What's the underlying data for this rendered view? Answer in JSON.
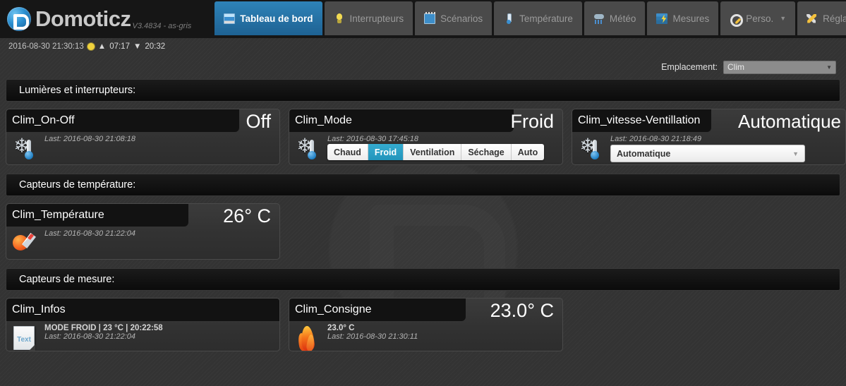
{
  "brand": {
    "name": "Domoticz",
    "version": "V3.4834 - as-gris",
    "logo_icon": "domoticz-logo-icon"
  },
  "nav": {
    "tabs": [
      {
        "label": "Tableau de bord",
        "icon": "dashboard-icon",
        "active": true,
        "caret": ""
      },
      {
        "label": "Interrupteurs",
        "icon": "lightbulb-icon",
        "active": false,
        "caret": ""
      },
      {
        "label": "Scénarios",
        "icon": "film-icon",
        "active": false,
        "caret": ""
      },
      {
        "label": "Température",
        "icon": "thermometer-icon",
        "active": false,
        "caret": ""
      },
      {
        "label": "Météo",
        "icon": "cloud-rain-icon",
        "active": false,
        "caret": ""
      },
      {
        "label": "Mesures",
        "icon": "bar-chart-icon",
        "active": false,
        "caret": ""
      },
      {
        "label": "Perso.",
        "icon": "gear-icon",
        "active": false,
        "caret": "▼"
      },
      {
        "label": "Réglages",
        "icon": "tools-icon",
        "active": false,
        "caret": "▼"
      }
    ]
  },
  "statusbar": {
    "datetime": "2016-08-30 21:30:13",
    "sun_icon": "sun-icon",
    "sunrise_arrow": "▲",
    "sunrise": "07:17",
    "sunset_arrow": "▼",
    "sunset": "20:32"
  },
  "location": {
    "label": "Emplacement:",
    "selected": "Clim",
    "caret": "▼"
  },
  "sections": [
    {
      "title": "Lumières et interrupteurs:",
      "cards": [
        {
          "name": "Clim_On-Off",
          "value": "Off",
          "icon": "snowflake-thermometer-icon",
          "last": "Last: 2016-08-30 21:08:18",
          "control": "none"
        },
        {
          "name": "Clim_Mode",
          "value": "Froid",
          "icon": "snowflake-thermometer-icon",
          "last": "Last: 2016-08-30 17:45:18",
          "control": "buttons",
          "buttons": [
            {
              "label": "Chaud",
              "selected": false
            },
            {
              "label": "Froid",
              "selected": true
            },
            {
              "label": "Ventilation",
              "selected": false
            },
            {
              "label": "Séchage",
              "selected": false
            },
            {
              "label": "Auto",
              "selected": false
            }
          ]
        },
        {
          "name": "Clim_vitesse-Ventillation",
          "value": "Automatique",
          "icon": "snowflake-thermometer-icon",
          "last": "Last: 2016-08-30 21:18:49",
          "control": "select",
          "select_value": "Automatique",
          "select_caret": "▼"
        }
      ]
    },
    {
      "title": "Capteurs de température:",
      "cards": [
        {
          "name": "Clim_Température",
          "value": "26° C",
          "icon": "sun-thermometer-icon",
          "last": "Last: 2016-08-30 21:22:04",
          "control": "none"
        }
      ]
    },
    {
      "title": "Capteurs de mesure:",
      "cards": [
        {
          "name": "Clim_Infos",
          "value": "",
          "icon": "text-sensor-icon",
          "info": "MODE FROID | 23 °C | 20:22:58",
          "last": "Last: 2016-08-30 21:22:04",
          "control": "none"
        },
        {
          "name": "Clim_Consigne",
          "value": "23.0° C",
          "icon": "flame-icon",
          "reading": "23.0° C",
          "last": "Last: 2016-08-30 21:30:11",
          "control": "none"
        }
      ]
    }
  ],
  "colors": {
    "accent_blue": "#2e83b8",
    "selected_button": "#2295bb",
    "page_bg": "#333333",
    "header_bg": "#161616",
    "card_bg": "#333333",
    "card_title_bg": "#121212"
  }
}
